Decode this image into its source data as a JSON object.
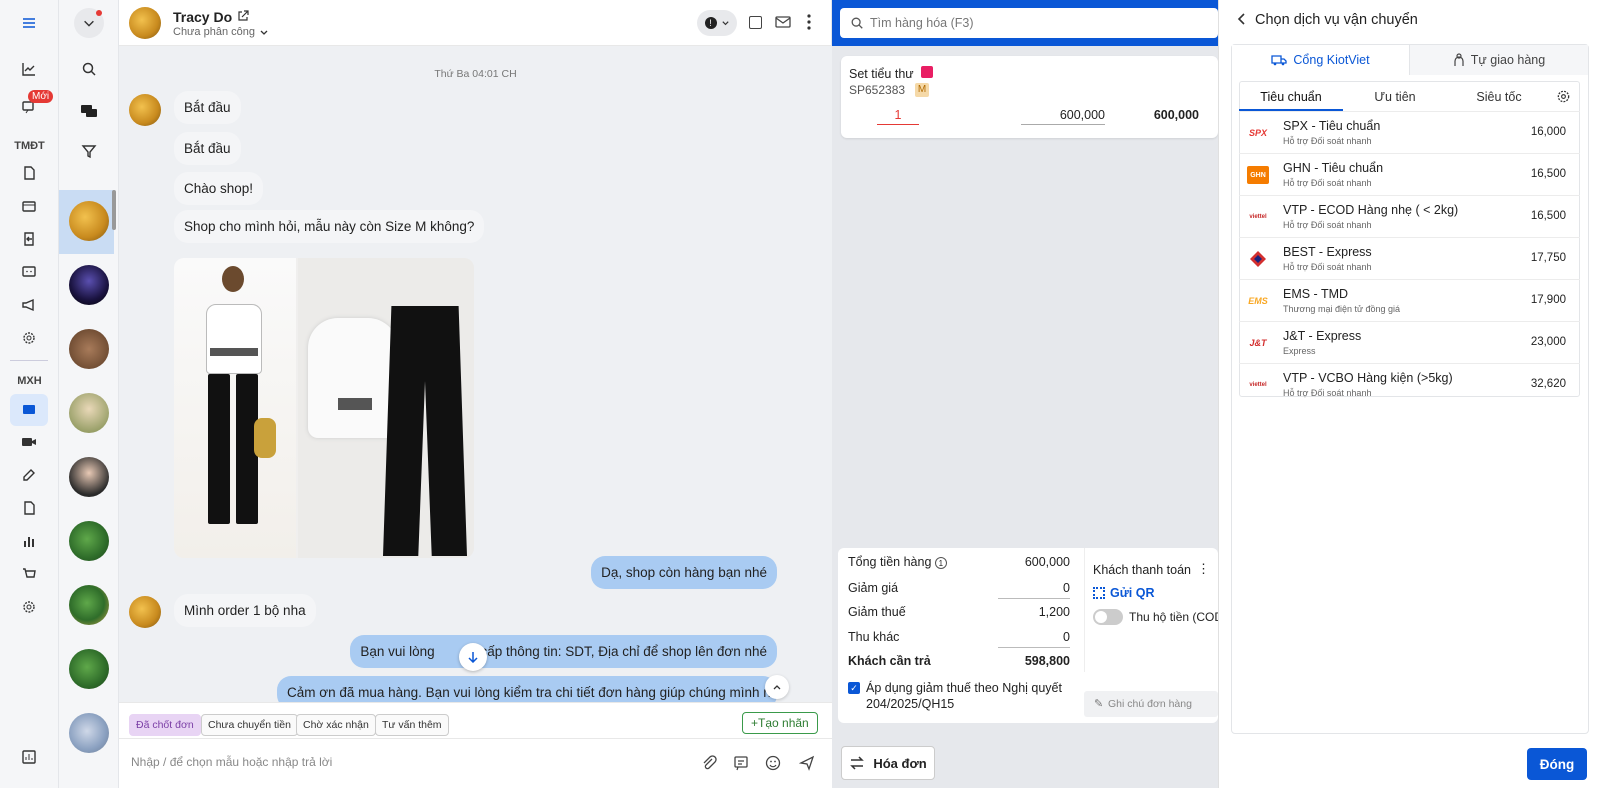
{
  "rail": {
    "new_badge": "Mới",
    "section_tmdt": "TMĐT",
    "section_mxh": "MXH"
  },
  "chat": {
    "contact_name": "Tracy Do",
    "assign_status": "Chưa phân công",
    "date_divider": "Thứ Ba 04:01 CH",
    "messages": {
      "m1": "Bắt đầu",
      "m2": "Bắt đầu",
      "m3": "Chào shop!",
      "m4": "Shop cho mình hỏi, mẫu này còn Size M không?",
      "m5": "Dạ, shop còn hàng bạn nhé",
      "m6": "Mình order 1 bộ nha",
      "m7": "Bạn vui lòng ",
      "m7b": "cấp thông tin: SDT, Địa chỉ để shop lên đơn nhé",
      "m8": "Cảm ơn đã mua hàng. Bạn vui lòng kiểm tra chi tiết đơn hàng giúp chúng mình nhé"
    },
    "tags": [
      "Đã chốt đơn",
      "Chưa chuyển tiền",
      "Chờ xác nhận",
      "Tư vấn thêm"
    ],
    "create_tag": "Tạo nhãn",
    "input_placeholder": "Nhập / để chọn mẫu hoặc nhập trả lời"
  },
  "pos": {
    "search_placeholder": "Tìm hàng hóa (F3)",
    "product": {
      "name": "Set tiểu thư",
      "sku": "SP652383",
      "size_badge": "M",
      "qty": "1",
      "price": "600,000",
      "total": "600,000"
    },
    "summary": {
      "subtotal_label": "Tổng tiền hàng",
      "subtotal": "600,000",
      "discount_label": "Giảm giá",
      "discount": "0",
      "tax_discount_label": "Giảm thuế",
      "tax_discount": "1,200",
      "other_label": "Thu khác",
      "other": "0",
      "due_label": "Khách cần trả",
      "due": "598,800",
      "payment_label": "Khách thanh toán",
      "qr_label": "Gửi QR",
      "cod_label": "Thu hộ tiền (COD",
      "tax_checkbox_label": "Áp dụng giảm thuế theo Nghị quyết 204/2025/QH15",
      "note_placeholder": "Ghi chú đơn hàng"
    },
    "invoice_button": "Hóa đơn"
  },
  "shipping": {
    "title": "Chọn dịch vụ vận chuyển",
    "tab_kiotviet": "Cổng KiotViet",
    "tab_self": "Tự giao hàng",
    "subtabs": [
      "Tiêu chuẩn",
      "Ưu tiên",
      "Siêu tốc"
    ],
    "services": [
      {
        "logo": "SPX",
        "name": "SPX - Tiêu chuẩn",
        "sub": "Hỗ trợ Đối soát nhanh",
        "price": "16,000",
        "color": "#e53935"
      },
      {
        "logo": "GHN",
        "name": "GHN - Tiêu chuẩn",
        "sub": "Hỗ trợ Đối soát nhanh",
        "price": "16,500",
        "color": "#f57c00"
      },
      {
        "logo": "viettel",
        "name": "VTP - ECOD Hàng nhẹ ( < 2kg)",
        "sub": "Hỗ trợ Đối soát nhanh",
        "price": "16,500",
        "color": "#c62828"
      },
      {
        "logo": "BEST",
        "name": "BEST - Express",
        "sub": "Hỗ trợ Đối soát nhanh",
        "price": "17,750",
        "color": "#d32f2f"
      },
      {
        "logo": "EMS",
        "name": "EMS - TMD",
        "sub": "Thương mại điện tử đồng giá",
        "price": "17,900",
        "color": "#f9a825"
      },
      {
        "logo": "J&T",
        "name": "J&T - Express",
        "sub": "Express",
        "price": "23,000",
        "color": "#d32f2f"
      },
      {
        "logo": "viettel",
        "name": "VTP - VCBO Hàng kiện (>5kg)",
        "sub": "Hỗ trợ Đối soát nhanh",
        "price": "32,620",
        "color": "#c62828"
      }
    ],
    "close_button": "Đóng"
  },
  "colors": {
    "accent": "#0a57d6",
    "bubble_me": "#a9cbf2"
  }
}
